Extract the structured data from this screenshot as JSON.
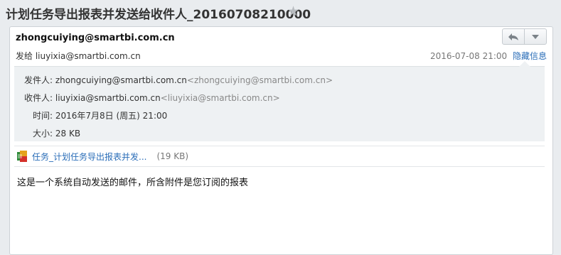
{
  "subject": "计划任务导出报表并发送给收件人_20160708210000",
  "header": {
    "sender_email": "zhongcuiying@smartbi.com.cn",
    "to_prefix": "发给",
    "to_email": "liuyixia@smartbi.com.cn",
    "date": "2016-07-08 21:00",
    "hide_info": "隐藏信息"
  },
  "details": {
    "from_label": "发件人:",
    "from_name": "zhongcuiying@smartbi.com.cn",
    "from_addr": "<zhongcuiying@smartbi.com.cn>",
    "to_label": "收件人:",
    "to_name": "liuyixia@smartbi.com.cn",
    "to_addr": "<liuyixia@smartbi.com.cn>",
    "time_label": "时间:",
    "time_value": "2016年7月8日 (周五) 21:00",
    "size_label": "大小:",
    "size_value": "28 KB"
  },
  "attachment": {
    "name": "任务_计划任务导出报表并发...",
    "size": "(19 KB)"
  },
  "body": "这是一个系统自动发送的邮件，所含附件是您订阅的报表",
  "icons": {
    "star": "star-icon",
    "reply": "reply-icon",
    "dropdown": "chevron-down-icon",
    "file": "excel-file-icon"
  }
}
